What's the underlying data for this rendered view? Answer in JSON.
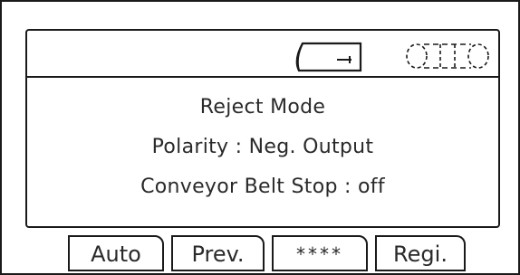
{
  "status_bar": {
    "belt_icon": "conveyor-belt-icon",
    "sensor_icon": "dashed-sensor-icon"
  },
  "main": {
    "mode_title": "Reject Mode",
    "polarity_line": "Polarity : Neg. Output",
    "conveyor_line": "Conveyor Belt Stop : off"
  },
  "softkeys": [
    {
      "label": "Auto"
    },
    {
      "label": "Prev."
    },
    {
      "label": "****"
    },
    {
      "label": "Regi."
    }
  ]
}
